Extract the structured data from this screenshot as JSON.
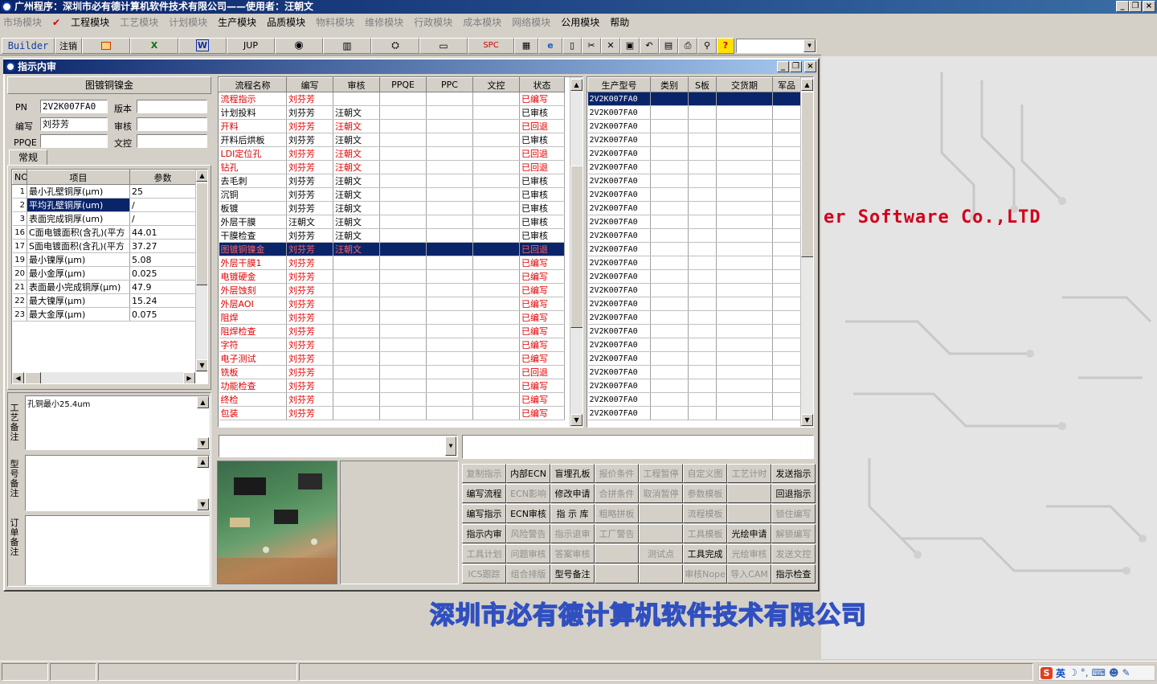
{
  "window": {
    "title": "广州程序：深圳市必有德计算机软件技术有限公司——使用者：汪朝文"
  },
  "menu": [
    "市场模块",
    "工程模块",
    "工艺模块",
    "计划模块",
    "生产模块",
    "品质模块",
    "物料模块",
    "维修模块",
    "行政模块",
    "成本模块",
    "网络模块",
    "公用模块",
    "帮助"
  ],
  "menu_enabled": [
    false,
    true,
    false,
    false,
    true,
    true,
    false,
    false,
    false,
    false,
    false,
    true,
    true
  ],
  "toolbar": {
    "builder": "Builder",
    "logout": "注销",
    "jup": "JUP",
    "spc": "SPC",
    "combo": ""
  },
  "toolbar_icons": [
    "chart-icon",
    "excel-icon",
    "word-icon",
    "eye-icon",
    "database-icon",
    "network-icon",
    "computer-icon",
    "spc-label",
    "calculator-icon",
    "ie-icon",
    "new-doc-icon",
    "cut-icon",
    "delete-icon",
    "save-icon",
    "undo-icon",
    "preview-icon",
    "print-icon",
    "find-icon",
    "help-icon"
  ],
  "brand": {
    "en": "er Software Co.,LTD",
    "cn": "深圳市必有德计算机软件技术有限公司"
  },
  "child": {
    "title": "指示内审"
  },
  "left": {
    "header": "图镀铜镍金",
    "pn_label": "PN",
    "pn": "2V2K007FA0",
    "version_label": "版本",
    "version": "",
    "editor_label": "编写",
    "editor": "刘芬芳",
    "review_label": "审核",
    "review": "",
    "ppqe_label": "PPQE",
    "ppqe": "",
    "control_label": "文控",
    "control": "",
    "tab": "常规",
    "params_headers": [
      "NO",
      "项目",
      "参数"
    ],
    "params": [
      [
        "1",
        "最小孔壁铜厚(μm)",
        "25"
      ],
      [
        "2",
        "平均孔壁铜厚(um)",
        "/"
      ],
      [
        "3",
        "表面完成铜厚(um)",
        "/"
      ],
      [
        "16",
        "C面电镀面积(含孔)(平方",
        "44.01"
      ],
      [
        "17",
        "S面电镀面积(含孔)(平方",
        "37.27"
      ],
      [
        "19",
        "最小镍厚(μm)",
        "5.08"
      ],
      [
        "20",
        "最小金厚(μm)",
        "0.025"
      ],
      [
        "21",
        "表面最小完成铜厚(μm)",
        "47.9"
      ],
      [
        "22",
        "最大镍厚(μm)",
        "15.24"
      ],
      [
        "23",
        "最大金厚(μm)",
        "0.075"
      ]
    ],
    "note1_label": "工艺备注",
    "note1": "孔铜最小25.4um",
    "note2_label": "型号备注",
    "note2": "",
    "note3_label": "订单备注",
    "note3": ""
  },
  "flow": {
    "headers": [
      "流程名称",
      "编写",
      "审核",
      "PPQE",
      "PPC",
      "文控",
      "状态"
    ],
    "rows": [
      [
        "流程指示",
        "刘芬芳",
        "",
        "",
        "",
        "",
        "已编写"
      ],
      [
        "计划投料",
        "刘芬芳",
        "汪朝文",
        "",
        "",
        "",
        "已审核"
      ],
      [
        "开料",
        "刘芬芳",
        "汪朝文",
        "",
        "",
        "",
        "已回退"
      ],
      [
        "开料后烘板",
        "刘芬芳",
        "汪朝文",
        "",
        "",
        "",
        "已审核"
      ],
      [
        "LDI定位孔",
        "刘芬芳",
        "汪朝文",
        "",
        "",
        "",
        "已回退"
      ],
      [
        "钻孔",
        "刘芬芳",
        "汪朝文",
        "",
        "",
        "",
        "已回退"
      ],
      [
        "去毛刺",
        "刘芬芳",
        "汪朝文",
        "",
        "",
        "",
        "已审核"
      ],
      [
        "沉铜",
        "刘芬芳",
        "汪朝文",
        "",
        "",
        "",
        "已审核"
      ],
      [
        "板镀",
        "刘芬芳",
        "汪朝文",
        "",
        "",
        "",
        "已审核"
      ],
      [
        "外层干膜",
        "汪朝文",
        "汪朝文",
        "",
        "",
        "",
        "已审核"
      ],
      [
        "干膜检查",
        "刘芬芳",
        "汪朝文",
        "",
        "",
        "",
        "已审核"
      ],
      [
        "图镀铜镍金",
        "刘芬芳",
        "汪朝文",
        "",
        "",
        "",
        "已回退"
      ],
      [
        "外层干膜1",
        "刘芬芳",
        "",
        "",
        "",
        "",
        "已编写"
      ],
      [
        "电镀硬金",
        "刘芬芳",
        "",
        "",
        "",
        "",
        "已编写"
      ],
      [
        "外层蚀刻",
        "刘芬芳",
        "",
        "",
        "",
        "",
        "已编写"
      ],
      [
        "外层AOI",
        "刘芬芳",
        "",
        "",
        "",
        "",
        "已编写"
      ],
      [
        "阻焊",
        "刘芬芳",
        "",
        "",
        "",
        "",
        "已编写"
      ],
      [
        "阻焊检查",
        "刘芬芳",
        "",
        "",
        "",
        "",
        "已编写"
      ],
      [
        "字符",
        "刘芬芳",
        "",
        "",
        "",
        "",
        "已编写"
      ],
      [
        "电子测试",
        "刘芬芳",
        "",
        "",
        "",
        "",
        "已编写"
      ],
      [
        "铣板",
        "刘芬芳",
        "",
        "",
        "",
        "",
        "已回退"
      ],
      [
        "功能检查",
        "刘芬芳",
        "",
        "",
        "",
        "",
        "已编写"
      ],
      [
        "终检",
        "刘芬芳",
        "",
        "",
        "",
        "",
        "已编写"
      ],
      [
        "包装",
        "刘芬芳",
        "",
        "",
        "",
        "",
        "已编写"
      ]
    ]
  },
  "orders": {
    "headers": [
      "生产型号",
      "类别",
      "S板",
      "交货期",
      "军品"
    ],
    "rows": [
      "2V2K007FA0",
      "2V2K007FA0",
      "2V2K007FA0",
      "2V2K007FA0",
      "2V2K007FA0",
      "2V2K007FA0",
      "2V2K007FA0",
      "2V2K007FA0",
      "2V2K007FA0",
      "2V2K007FA0",
      "2V2K007FA0",
      "2V2K007FA0",
      "2V2K007FA0",
      "2V2K007FA0",
      "2V2K007FA0",
      "2V2K007FA0",
      "2V2K007FA0",
      "2V2K007FA0",
      "2V2K007FA0",
      "2V2K007FA0",
      "2V2K007FA0",
      "2V2K007FA0",
      "2V2K007FA0",
      "2V2K007FA0"
    ]
  },
  "combo_value": "",
  "remark_value": "",
  "actions": [
    [
      {
        "t": "复制指示",
        "e": false
      },
      {
        "t": "内部ECN",
        "e": true
      },
      {
        "t": "盲埋孔板",
        "e": true
      },
      {
        "t": "报价条件",
        "e": false
      },
      {
        "t": "工程暂停",
        "e": false
      },
      {
        "t": "自定义图",
        "e": false
      },
      {
        "t": "工艺计时",
        "e": false
      },
      {
        "t": "发送指示",
        "e": true
      }
    ],
    [
      {
        "t": "编写流程",
        "e": true
      },
      {
        "t": "ECN影响",
        "e": false
      },
      {
        "t": "修改申请",
        "e": true
      },
      {
        "t": "合拼条件",
        "e": false
      },
      {
        "t": "取消暂停",
        "e": false
      },
      {
        "t": "参数模板",
        "e": false
      },
      {
        "t": "",
        "e": false
      },
      {
        "t": "回退指示",
        "e": true
      }
    ],
    [
      {
        "t": "编写指示",
        "e": true
      },
      {
        "t": "ECN审核",
        "e": true
      },
      {
        "t": "指 示 库",
        "e": true
      },
      {
        "t": "粗略拼板",
        "e": false
      },
      {
        "t": "",
        "e": false
      },
      {
        "t": "流程模板",
        "e": false
      },
      {
        "t": "",
        "e": false
      },
      {
        "t": "锁住编写",
        "e": false
      }
    ],
    [
      {
        "t": "指示内审",
        "e": true
      },
      {
        "t": "风险警告",
        "e": false
      },
      {
        "t": "指示退审",
        "e": false
      },
      {
        "t": "工厂警告",
        "e": false
      },
      {
        "t": "",
        "e": false
      },
      {
        "t": "工具模板",
        "e": false
      },
      {
        "t": "光绘申请",
        "e": true
      },
      {
        "t": "解锁编写",
        "e": false
      }
    ],
    [
      {
        "t": "工具计划",
        "e": false
      },
      {
        "t": "问题审核",
        "e": false
      },
      {
        "t": "答案审核",
        "e": false
      },
      {
        "t": "",
        "e": false
      },
      {
        "t": "测试点",
        "e": false
      },
      {
        "t": "工具完成",
        "e": true
      },
      {
        "t": "光绘审核",
        "e": false
      },
      {
        "t": "发送文控",
        "e": false
      }
    ],
    [
      {
        "t": "ICS跟踪",
        "e": false
      },
      {
        "t": "组合排版",
        "e": false
      },
      {
        "t": "型号备注",
        "e": true
      },
      {
        "t": "",
        "e": false
      },
      {
        "t": "",
        "e": false
      },
      {
        "t": "审核Nope",
        "e": false
      },
      {
        "t": "导入CAM",
        "e": false
      },
      {
        "t": "指示检查",
        "e": true
      }
    ]
  ],
  "tray": {
    "ime": "英"
  }
}
